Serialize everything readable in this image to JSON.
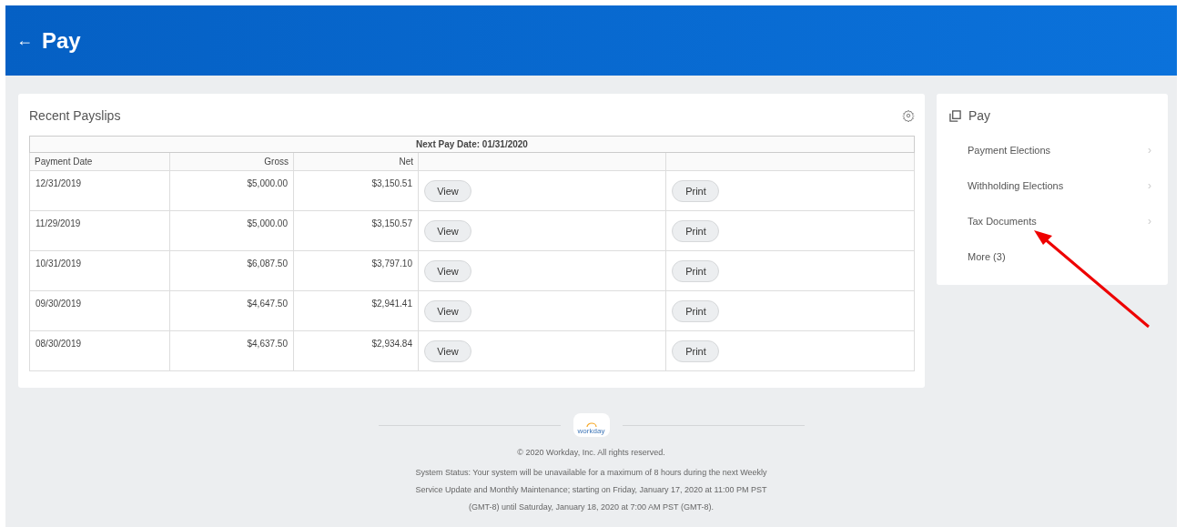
{
  "header": {
    "back": "←",
    "title": "Pay"
  },
  "payslips": {
    "title": "Recent Payslips",
    "next_pay": "Next Pay Date: 01/31/2020",
    "columns": [
      "Payment Date",
      "Gross",
      "Net"
    ],
    "rows": [
      {
        "date": "12/31/2019",
        "gross": "$5,000.00",
        "net": "$3,150.51",
        "view": "View",
        "print": "Print"
      },
      {
        "date": "11/29/2019",
        "gross": "$5,000.00",
        "net": "$3,150.57",
        "view": "View",
        "print": "Print"
      },
      {
        "date": "10/31/2019",
        "gross": "$6,087.50",
        "net": "$3,797.10",
        "view": "View",
        "print": "Print"
      },
      {
        "date": "09/30/2019",
        "gross": "$4,647.50",
        "net": "$2,941.41",
        "view": "View",
        "print": "Print"
      },
      {
        "date": "08/30/2019",
        "gross": "$4,637.50",
        "net": "$2,934.84",
        "view": "View",
        "print": "Print"
      }
    ]
  },
  "sidebar": {
    "title": "Pay",
    "items": [
      {
        "label": "Payment Elections",
        "chevron": "›"
      },
      {
        "label": "Withholding Elections",
        "chevron": "›"
      },
      {
        "label": "Tax Documents",
        "chevron": "›"
      },
      {
        "label": "More (3)"
      }
    ]
  },
  "footer": {
    "logo_text": "workday",
    "copyright": "© 2020 Workday, Inc. All rights reserved.",
    "status": "System Status: Your system will be unavailable for a maximum of 8 hours during the next Weekly Service Update and Monthly Maintenance; starting on Friday, January 17, 2020 at 11:00 PM PST (GMT-8) until Saturday, January 18, 2020 at 7:00 AM PST (GMT-8)."
  }
}
